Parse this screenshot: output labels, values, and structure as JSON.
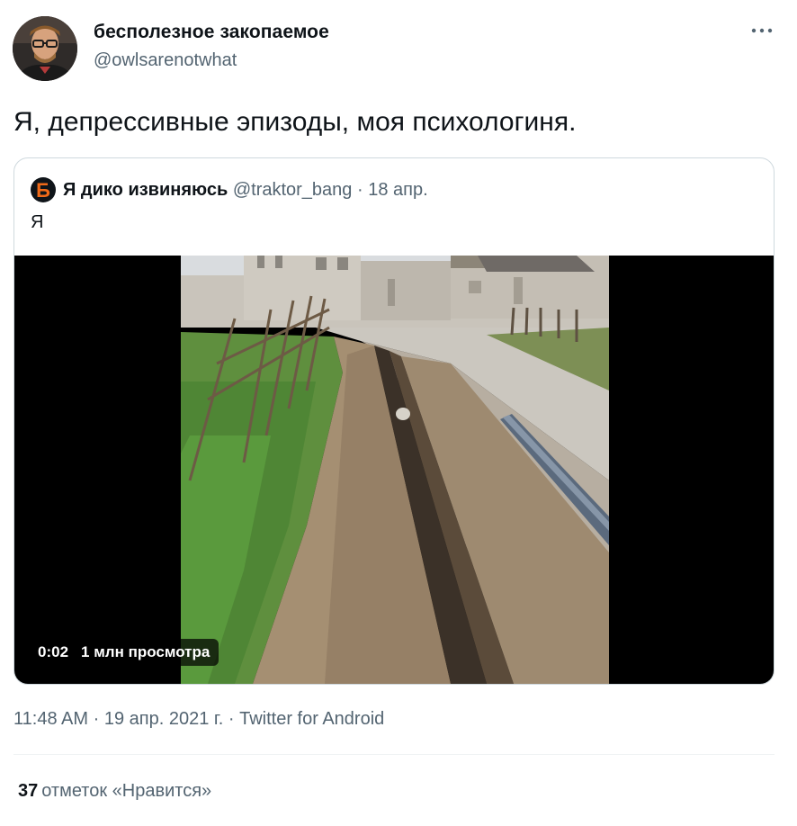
{
  "author": {
    "name": "бесполезное закопаемое",
    "handle": "@owlsarenotwhat"
  },
  "tweet": {
    "text": "Я, депрессивные эпизоды, моя психологиня."
  },
  "quoted": {
    "avatar_letter": "Б",
    "name": "Я дико извиняюсь",
    "handle": "@traktor_bang",
    "separator": "·",
    "date": "18 апр.",
    "text": "Я",
    "video": {
      "time": "0:02",
      "views": "1 млн просмотра"
    }
  },
  "meta": {
    "time": "11:48 AM",
    "separator": "·",
    "date": "19 апр. 2021 г.",
    "source": "Twitter for Android"
  },
  "likes": {
    "count": "37",
    "label": "отметок «Нравится»"
  },
  "icons": {
    "more": "more-horizontal-icon",
    "quoted_avatar": "b-logo-icon"
  },
  "colors": {
    "text": "#0f1419",
    "secondary": "#536471",
    "border": "#cfd9de",
    "quoted_avatar_letter": "#f06a19"
  }
}
